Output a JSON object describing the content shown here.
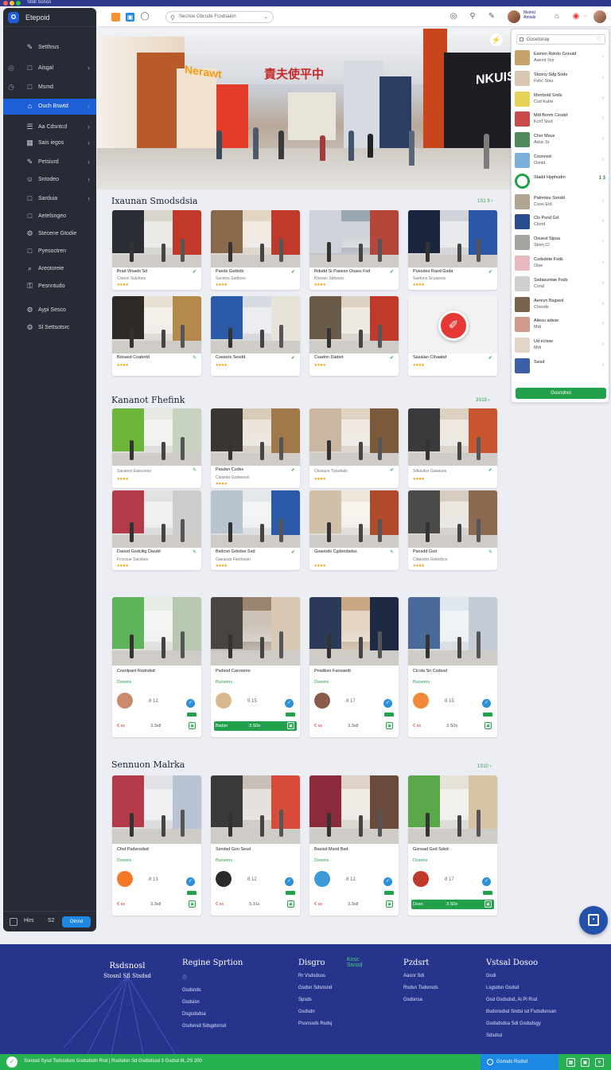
{
  "window": {
    "title": "Stoll Sonos"
  },
  "sidebar": {
    "app_name": "Etepoid",
    "items": [
      {
        "label": "Setthrus",
        "prefix": "",
        "chevron": false,
        "active": false,
        "icon": "pen-icon"
      },
      {
        "label": "Aisgal",
        "prefix": "◎",
        "chevron": true,
        "active": false,
        "icon": "box-icon"
      },
      {
        "label": "Msmd",
        "prefix": "◷",
        "chevron": false,
        "active": false,
        "icon": "box-icon"
      },
      {
        "label": "Ouch Bswtd",
        "prefix": "",
        "chevron": true,
        "active": true,
        "icon": "store-icon"
      },
      {
        "label": "Aa Cdsntcd",
        "prefix": "",
        "chevron": true,
        "active": false,
        "icon": "list-icon"
      },
      {
        "label": "Sais iegos",
        "prefix": "",
        "chevron": true,
        "active": false,
        "icon": "grid-icon"
      },
      {
        "label": "Petsiurd",
        "prefix": "",
        "chevron": true,
        "active": false,
        "icon": "pen-icon"
      },
      {
        "label": "Sntodeo",
        "prefix": "",
        "chevron": true,
        "active": false,
        "icon": "user-icon"
      },
      {
        "label": "Sarduia",
        "prefix": "",
        "chevron": true,
        "active": false,
        "icon": "box-icon"
      },
      {
        "label": "Aetelsngeo",
        "prefix": "",
        "chevron": false,
        "active": false,
        "icon": "box-icon"
      },
      {
        "label": "Stecene Gtodie",
        "prefix": "",
        "chevron": false,
        "active": false,
        "icon": "gear-icon"
      },
      {
        "label": "Pyesoctren",
        "prefix": "",
        "chevron": false,
        "active": false,
        "icon": "box-icon"
      },
      {
        "label": "Areotoreie",
        "prefix": "",
        "chevron": false,
        "active": false,
        "icon": "search-icon"
      },
      {
        "label": "Pesnntudo",
        "prefix": "",
        "chevron": false,
        "active": false,
        "icon": "lock-icon"
      },
      {
        "label": "Aypi Sesco",
        "prefix": "",
        "chevron": false,
        "active": false,
        "icon": "gear-icon"
      },
      {
        "label": "Sl Settsotsrc",
        "prefix": "",
        "chevron": false,
        "active": false,
        "icon": "gear-icon"
      }
    ],
    "footer": {
      "label": "Hirs",
      "count": "S2",
      "button": "Otnnd"
    }
  },
  "topbar": {
    "search_placeholder": "Secnoe Gbcsde Fcsdsaion",
    "user_name": "Mslntd",
    "user_sub": "Atnsds"
  },
  "hero": {
    "sign": "責夫使平中",
    "store_a": "Nerawt",
    "store_b": "NKUIS"
  },
  "right_panel": {
    "search_placeholder": "Gosetsiray",
    "items": [
      {
        "title": "Esmsn Rsloto Gnoutd",
        "sub": "Asemt Srs",
        "badge": ""
      },
      {
        "title": "Stosny Sdg Sods",
        "sub": "Fvhc Stsu",
        "badge": ""
      },
      {
        "title": "Mvrrbstd Snds",
        "sub": "Csd Kutre",
        "badge": ""
      },
      {
        "title": "Mdl Bsnm Cesdd",
        "sub": "Kcnf Siud",
        "badge": ""
      },
      {
        "title": "Chsr Msus",
        "sub": "Aduc Sr",
        "badge": ""
      },
      {
        "title": "Csonosd",
        "sub": "Osnld",
        "badge": ""
      },
      {
        "title": "Stadd Hpphudm",
        "sub": "",
        "badge": "1 3"
      },
      {
        "title": "Patnnleu Ssndd",
        "sub": "Csoo Etd",
        "badge": ""
      },
      {
        "title": "Cls Psnd Gd",
        "sub": "Clnnd",
        "badge": ""
      },
      {
        "title": "Osuest Stpsa",
        "sub": "Stom Cl",
        "badge": ""
      },
      {
        "title": "Csdsdete Fsds",
        "sub": "Olse",
        "badge": ""
      },
      {
        "title": "Ssdasuntae Fsds",
        "sub": "Csnd",
        "badge": ""
      },
      {
        "title": "Aereyn Bsgsed",
        "sub": "Chsnds",
        "badge": ""
      },
      {
        "title": "Aliesu adsse",
        "sub": "Mdt",
        "badge": ""
      },
      {
        "title": "Ud eclsse",
        "sub": "Mdt",
        "badge": ""
      },
      {
        "title": "Ssisd",
        "sub": "",
        "badge": ""
      }
    ],
    "button": "Gosndnoi"
  },
  "sections": [
    {
      "title": "Ixaunan Smodsdsia",
      "link": "1S1 9 ›"
    },
    {
      "title": "Kananot Fhefink",
      "link": "3S19 ›"
    },
    {
      "title": "",
      "link": ""
    },
    {
      "title": "Sennuon Malrka",
      "link": "1S10 ›"
    }
  ],
  "cards1": [
    {
      "caption": "Brad Wsads Sd",
      "sub": "Cisonn Sulsfoos",
      "icon": "check-icon"
    },
    {
      "caption": "Pasds Gsdsds",
      "sub": "Sacelos Sadbors",
      "icon": "check-icon"
    },
    {
      "caption": "Rdudd Si Paseso Osass Fsd",
      "sub": "Kheosn Sdbsoss",
      "icon": "check-icon"
    },
    {
      "caption": "Puesdes Rasd Gsda",
      "sub": "Saetuns Scuasoss",
      "icon": "check-icon"
    },
    {
      "caption": "Bdoasd Coabntd",
      "sub": "",
      "icon": "pen-icon"
    },
    {
      "caption": "Cseasrs Sesdd",
      "sub": "",
      "icon": "check-icon"
    },
    {
      "caption": "Csadnn Dadsrt",
      "sub": "",
      "icon": "check-icon"
    },
    {
      "caption": "Sasalan Cthaabd",
      "sub": "",
      "icon": "check-icon"
    }
  ],
  "cards2": [
    {
      "caption": "",
      "sub": "Sacanoo Eascosoo",
      "icon": "pen-icon"
    },
    {
      "caption": "Pasdsn Csdss",
      "sub": "Cisasda Gsdoeaon",
      "icon": "check-icon"
    },
    {
      "caption": "",
      "sub": "Ckosuoe Tsasdsds",
      "icon": "check-icon"
    },
    {
      "caption": "",
      "sub": "Sdiocdus Gaeauos",
      "icon": "check-icon"
    },
    {
      "caption": "Daoud Gsdcliig Dasdd",
      "sub": "Fcvcsue Sacsbes",
      "icon": "pen-icon"
    },
    {
      "caption": "Bsdcsn Gdsdse Ssd",
      "sub": "Gaeasua Fandasan",
      "icon": "check-icon"
    },
    {
      "caption": "Gsaoods Cgdsndsdss",
      "sub": "",
      "icon": "pen-icon"
    },
    {
      "caption": "Psosdd Gsd",
      "sub": "Cidasdra Gsdsdscs",
      "icon": "pen-icon"
    }
  ],
  "cards3": [
    {
      "caption": "Cosnlpanl Rsdndsd",
      "badge": "Dssons",
      "num": "8 12",
      "price": "€ ss",
      "price2": "3.3s8",
      "green": false
    },
    {
      "caption": "Psdsod Caroseno",
      "badge": "Bsosons",
      "num": "5 15",
      "price": "Bsdsn",
      "price2": "3.S0s",
      "green": true
    },
    {
      "caption": "Pnsdbsn Fansaedt",
      "badge": "Dssons",
      "num": "8 17",
      "price": "€ ss",
      "price2": "3.3s8",
      "green": false
    },
    {
      "caption": "Clcsla Sn Csdssd",
      "badge": "Bsosons",
      "num": "8 15",
      "price": "€ ss",
      "price2": "3.S0s",
      "green": false
    }
  ],
  "cards4": [
    {
      "caption": "Cfsd Psdsnsdsd",
      "badge": "Dssons",
      "num": "8 13",
      "price": "€ ss",
      "price2": "3.3s8",
      "green": false
    },
    {
      "caption": "Ssndsd Gsn Sesd",
      "badge": "Bsosons",
      "num": "8 12",
      "price": "€ ss",
      "price2": "5.31s",
      "green": false
    },
    {
      "caption": "Basisd Msnd Bsd",
      "badge": "Dssons",
      "num": "8 12",
      "price": "€ ss",
      "price2": "3.3s8",
      "green": false
    },
    {
      "caption": "Gsnsad Gsd Sdsd",
      "badge": "Dssons",
      "num": "8 17",
      "price": "Dssn",
      "price2": "3.S0s",
      "green": true
    }
  ],
  "footer": {
    "brand_line1": "Rsdsnosl",
    "brand_line2": "Stosnl Sfl Stsdsd",
    "cols": [
      {
        "heading": "Regine Sprtion",
        "items": [
          "ⓘ",
          "Gsdsnds",
          "Gsdsisn",
          "Dsgsdsdsa",
          "Gsdsnsd Sdsgdsnsd"
        ]
      },
      {
        "heading": "Disgro",
        "items": [
          "Rr Vsdsdsos",
          "Gsdsn Sdsnsnd",
          "Spsds",
          "Gsdsdn",
          "Pssnssds Rsdsj"
        ]
      },
      {
        "heading": "Pzdsrt",
        "items": [
          "Aasnr Sdi",
          "Rsdsn Tsdsnsds",
          "Gsdsnsa"
        ]
      },
      {
        "heading": "Vstsal Dosoo",
        "items": [
          "Gsdi",
          "Lsgsdsn Gsdsd",
          "Gsd Gsdsdsd, Ai Pi Rsd",
          "Bsdsnsdsd Sndsi sd Fsdsdsnsan",
          "Gsdsdsdsa Sdi Gsdsdsgy",
          "Sdsdsd"
        ]
      }
    ],
    "sub_green": "Knsc\nSsnsd"
  },
  "statusbar": {
    "text": "Ssnssd Sysd Tsdssdsns Gsdsdsdn Rsd | Rsdsdsn Sd Gsdsdssd 3 Gsdsd 8t, 2S 200",
    "button": "Gsnsds Rsdsd"
  }
}
